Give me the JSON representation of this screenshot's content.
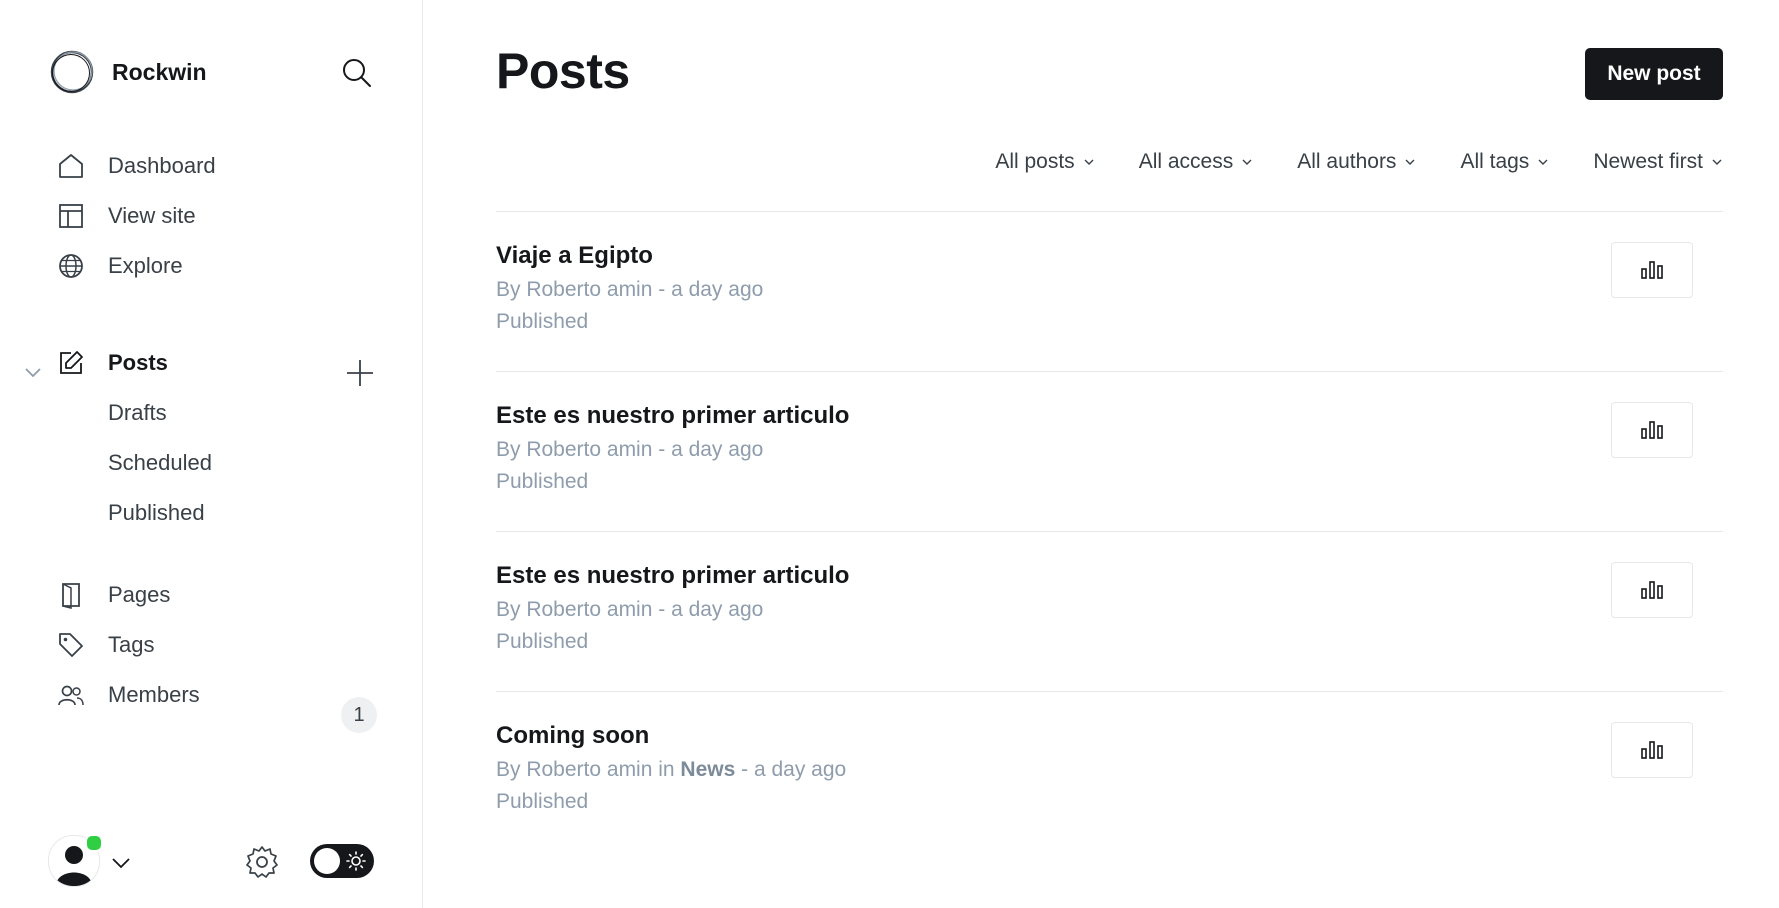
{
  "brand": {
    "name": "Rockwin"
  },
  "sidebar": {
    "top_items": [
      {
        "label": "Dashboard",
        "icon": "home-icon"
      },
      {
        "label": "View site",
        "icon": "layout-icon"
      },
      {
        "label": "Explore",
        "icon": "globe-icon"
      }
    ],
    "posts": {
      "label": "Posts",
      "icon": "edit-icon",
      "sub_items": [
        {
          "label": "Drafts"
        },
        {
          "label": "Scheduled"
        },
        {
          "label": "Published"
        }
      ]
    },
    "bottom_items": [
      {
        "label": "Pages",
        "icon": "page-icon"
      },
      {
        "label": "Tags",
        "icon": "tag-icon"
      },
      {
        "label": "Members",
        "icon": "members-icon",
        "badge": "1"
      }
    ]
  },
  "main": {
    "title": "Posts",
    "new_post_label": "New post",
    "filters": [
      {
        "label": "All posts"
      },
      {
        "label": "All access"
      },
      {
        "label": "All authors"
      },
      {
        "label": "All tags"
      },
      {
        "label": "Newest first"
      }
    ],
    "posts": [
      {
        "title": "Viaje a Egipto",
        "meta_prefix": "By Roberto amin - a day ago",
        "status": "Published"
      },
      {
        "title": "Este es nuestro primer articulo",
        "meta_prefix": "By Roberto amin - a day ago",
        "status": "Published"
      },
      {
        "title": "Este es nuestro primer articulo",
        "meta_prefix": "By Roberto amin - a day ago",
        "status": "Published"
      },
      {
        "title": "Coming soon",
        "meta_prefix": "By Roberto amin in ",
        "meta_tag": "News",
        "meta_suffix": " - a day ago",
        "status": "Published"
      }
    ]
  },
  "colors": {
    "accent": "#15171a",
    "online": "#30cf43",
    "muted": "#8e9cac",
    "border": "#e6e9eb"
  }
}
